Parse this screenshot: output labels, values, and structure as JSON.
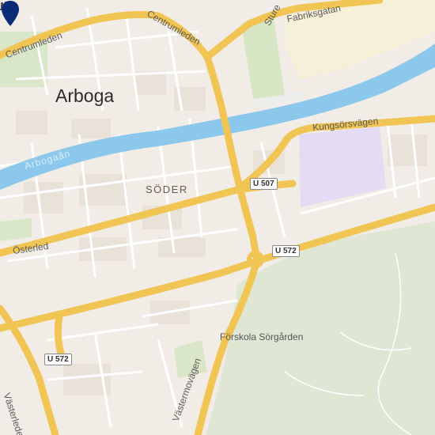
{
  "map": {
    "city": "Arboga",
    "district": "SÖDER",
    "streets": {
      "centrumleden_left": "Centrumleden",
      "centrumleden_right": "Centrumleden",
      "storgatan": "Sture",
      "fabriksgatan": "Fabriksgatan",
      "kungsorsvagen": "Kungsörsvägen",
      "osterled": "Österled",
      "vasterleden": "Västerleden",
      "vastermovagen": "Västermovägen"
    },
    "water": {
      "upper": "Arbogaån",
      "lower": "Arbogaån"
    },
    "shields": {
      "u507": "U 507",
      "u572_east": "U 572",
      "u572_west": "U 572"
    },
    "poi": {
      "name": "Förskola Sörgården",
      "icon": "school-icon"
    },
    "marker": {
      "icon": "location-pin-icon",
      "color": "#0b2a78"
    },
    "colors": {
      "road_major": "#f5cf63",
      "road_minor": "#ffffff",
      "river": "#8cc8ec",
      "park": "#d6e6c4",
      "campus": "#e4dcf5",
      "industrial": "#f6f0d8"
    }
  }
}
